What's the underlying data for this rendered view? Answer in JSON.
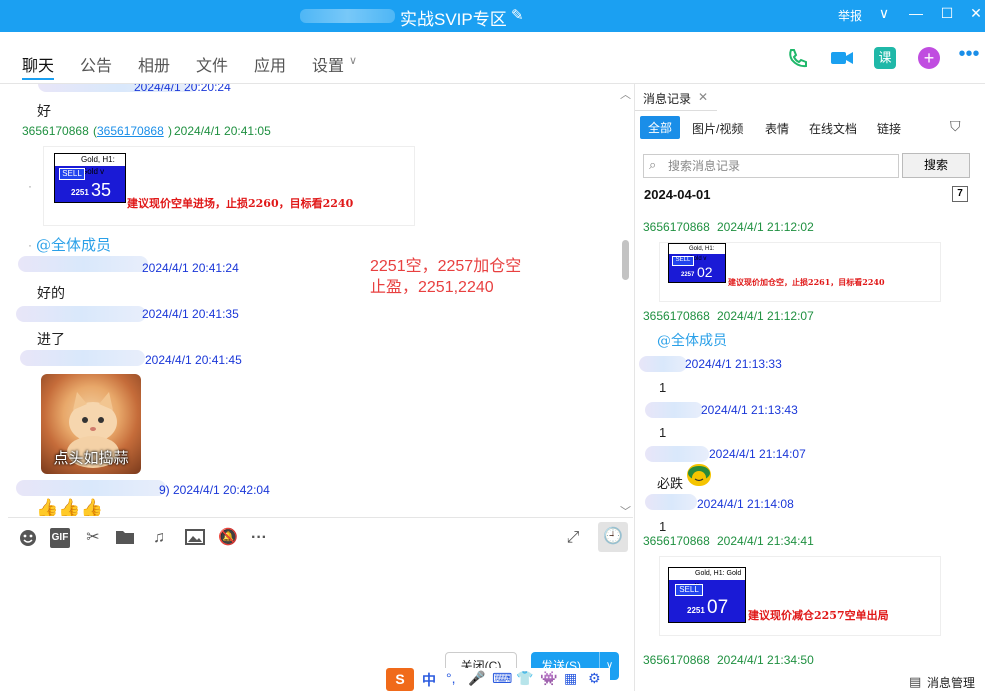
{
  "window": {
    "title": "实战SVIP专区",
    "report": "举报",
    "controls": {
      "collapse": "∨",
      "minimize": "—",
      "maximize": "☐",
      "close": "✕"
    }
  },
  "nav": {
    "tabs": [
      "聊天",
      "公告",
      "相册",
      "文件",
      "应用",
      "设置"
    ],
    "active_tab": "聊天",
    "settings_caret": "∨",
    "course_label": "课"
  },
  "chat": {
    "messages": [
      {
        "time": "2024/4/1 20:20:24",
        "text": "好"
      },
      {
        "sender": "3656170868",
        "sender_link": "3656170868",
        "time": "2024/4/1 20:41:05",
        "card": {
          "header": "Gold, H1: Gold v",
          "sell": "SELL",
          "price_small": "2251",
          "price_big": "35",
          "note": "建议现价空单进场，止损2260，目标看2240"
        }
      },
      {
        "mention": "@全体成员"
      },
      {
        "time": "2024/4/1 20:41:24",
        "text": "好的"
      },
      {
        "time": "2024/4/1 20:41:35",
        "text": "进了"
      },
      {
        "time": "2024/4/1 20:41:45",
        "sticker_caption": "点头如捣蒜"
      },
      {
        "time_prefix": "9)",
        "time": "2024/4/1 20:42:04",
        "text": "👍👍👍"
      }
    ],
    "annotation": "2251空，2257加仓空\n止盈，2251,2240",
    "scroll_up": "︿",
    "scroll_down": "﹀"
  },
  "input_toolbar": {
    "icons": [
      "emoji-icon",
      "gif-icon",
      "scissors-icon",
      "folder-icon",
      "music-icon",
      "image-icon",
      "mute-icon",
      "more-icon"
    ],
    "gif_label": "GIF",
    "more_label": "···"
  },
  "buttons": {
    "close": "关闭(C)",
    "send": "发送(S)",
    "send_caret": "∨"
  },
  "ime": {
    "items": [
      "S",
      "中",
      "°,",
      "🎤",
      "⌨",
      "👕",
      "👾",
      "▦",
      "⚙"
    ]
  },
  "history": {
    "tab": "消息记录",
    "filters": [
      "全部",
      "图片/视频",
      "表情",
      "在线文档",
      "链接"
    ],
    "active_filter": "全部",
    "search_placeholder": "搜索消息记录",
    "search_button": "搜索",
    "date": "2024-04-01",
    "calendar_label": "7",
    "entries": [
      {
        "sender": "3656170868",
        "time": "2024/4/1 21:12:02",
        "card": {
          "header": "Gold, H1: Gold v",
          "sell": "SELL",
          "price_small": "2257",
          "price_big": "02",
          "note": "建议现价加仓空，止损2261，目标看2240"
        }
      },
      {
        "sender": "3656170868",
        "time": "2024/4/1 21:12:07",
        "mention": "@全体成员"
      },
      {
        "time": "2024/4/1 21:13:33",
        "text": "1"
      },
      {
        "time": "2024/4/1 21:13:43",
        "text": "1"
      },
      {
        "time": "2024/4/1 21:14:07",
        "text": "必跌"
      },
      {
        "time": "2024/4/1 21:14:08",
        "text": "1"
      },
      {
        "sender": "3656170868",
        "time": "2024/4/1 21:34:41",
        "card": {
          "header": "Gold, H1: Gold v",
          "sell": "SELL",
          "price_small": "2251",
          "price_big": "07",
          "note": "建议现价减仓2257空单出局"
        }
      },
      {
        "sender": "3656170868",
        "time": "2024/4/1 21:34:50"
      }
    ],
    "manage": "消息管理"
  },
  "colors": {
    "accent": "#1ba0f2",
    "sender_green": "#1f9040",
    "time_blue": "#1a37d8",
    "annotation_red": "#e84040"
  }
}
